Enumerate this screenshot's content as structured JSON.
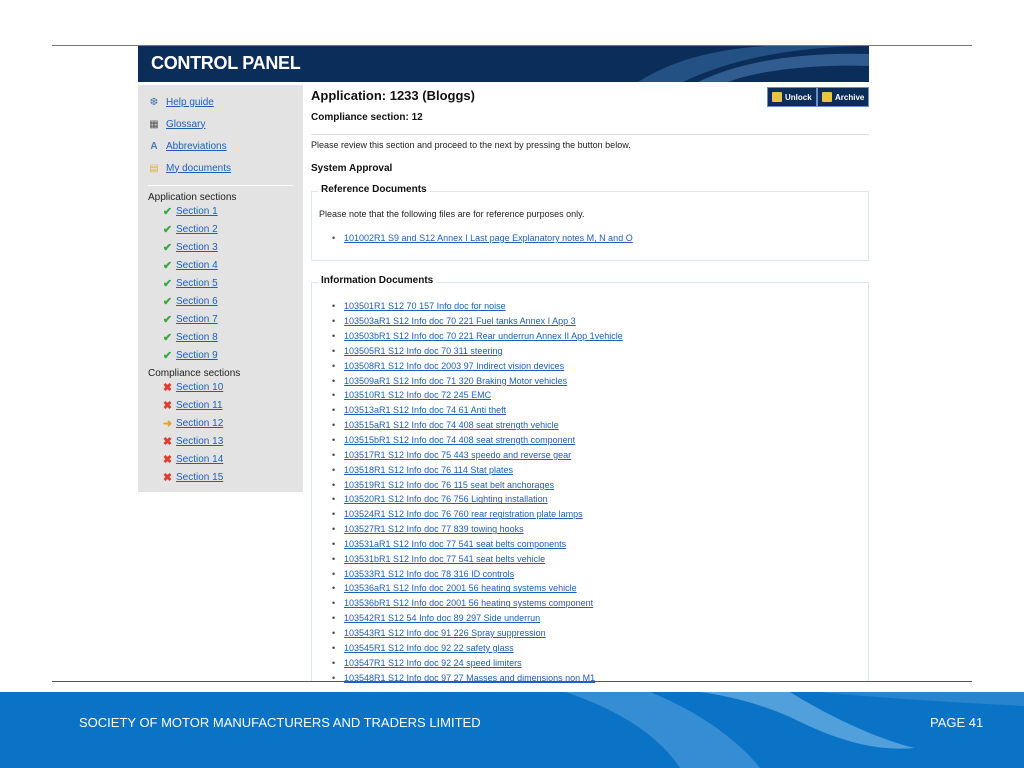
{
  "header": {
    "title": "CONTROL PANEL"
  },
  "sidebar": {
    "links": [
      {
        "label": "Help guide",
        "icon": "help-icon"
      },
      {
        "label": "Glossary",
        "icon": "glossary-icon"
      },
      {
        "label": "Abbreviations",
        "icon": "abbreviations-icon"
      },
      {
        "label": "My documents",
        "icon": "folder-icon"
      }
    ],
    "application_heading": "Application sections",
    "application_sections": [
      {
        "label": "Section 1",
        "status": "complete"
      },
      {
        "label": "Section 2",
        "status": "complete"
      },
      {
        "label": "Section 3",
        "status": "complete"
      },
      {
        "label": "Section 4",
        "status": "complete"
      },
      {
        "label": "Section 5",
        "status": "complete"
      },
      {
        "label": "Section 6",
        "status": "complete"
      },
      {
        "label": "Section 7",
        "status": "complete"
      },
      {
        "label": "Section 8",
        "status": "complete"
      },
      {
        "label": "Section 9",
        "status": "complete"
      }
    ],
    "compliance_heading": "Compliance sections",
    "compliance_sections": [
      {
        "label": "Section 10",
        "status": "incomplete"
      },
      {
        "label": "Section 11",
        "status": "incomplete"
      },
      {
        "label": "Section 12",
        "status": "current"
      },
      {
        "label": "Section 13",
        "status": "incomplete"
      },
      {
        "label": "Section 14",
        "status": "incomplete"
      },
      {
        "label": "Section 15",
        "status": "incomplete"
      }
    ]
  },
  "main": {
    "application_title": "Application: 1233 (Bloggs)",
    "compliance_title": "Compliance section: 12",
    "unlock_label": "Unlock",
    "archive_label": "Archive",
    "instructions": "Please review this section and proceed to the next by pressing the button below.",
    "system_approval": "System Approval",
    "reference": {
      "legend": "Reference Documents",
      "note": "Please note that the following files are for reference purposes only.",
      "links": [
        "101002R1 S9 and S12 Annex I Last page Explanatory notes M, N and O"
      ]
    },
    "information": {
      "legend": "Information Documents",
      "links": [
        "103501R1 S12 70 157 Info doc for noise",
        "103503aR1 S12 Info doc 70 221 Fuel tanks Annex I App 3",
        "103503bR1 S12 Info doc 70 221 Rear underrun Annex II App 1vehicle",
        "103505R1 S12 Info doc 70 311 steering",
        "103508R1 S12 Info doc 2003 97 Indirect vision devices",
        "103509aR1 S12 Info doc 71 320 Braking Motor vehicles",
        "103510R1 S12 Info doc 72 245 EMC",
        "103513aR1 S12 Info doc 74 61 Anti theft",
        "103515aR1 S12 Info doc 74 408 seat strength vehicle",
        "103515bR1 S12 Info doc 74 408 seat strength component",
        "103517R1 S12 Info doc 75 443 speedo and reverse gear",
        "103518R1 S12 Info doc 76 114 Stat plates",
        "103519R1 S12 Info doc 76 115 seat belt anchorages",
        "103520R1 S12 Info doc 76 756 Lighting installation",
        "103524R1 S12 Info doc 76 760 rear registration plate lamps",
        "103527R1 S12 Info doc 77 839 towing hooks",
        "103531aR1 S12 Info doc 77 541 seat belts components",
        "103531bR1 S12 Info doc 77 541 seat belts vehicle",
        "103533R1 S12 Info doc 78 316 ID controls",
        "103536aR1 S12 Info doc 2001 56 heating systems vehicle",
        "103536bR1 S12 Info doc 2001 56 heating systems component",
        "103542R1 S12 54 Info doc 89 297 Side underrun",
        "103543R1 S12 Info doc 91 226 Spray suppression",
        "103545R1 S12 Info doc 92 22 safety glass",
        "103547R1 S12 Info doc 92 24 speed limiters",
        "103548R1 S12 Info doc 97 27 Masses and dimensions non M1"
      ]
    }
  },
  "footer": {
    "org": "SOCIETY OF MOTOR MANUFACTURERS AND TRADERS LIMITED",
    "page": "PAGE 41"
  },
  "colors": {
    "header_bg": "#0a2d59",
    "footer_bg": "#0a73c6",
    "link": "#1f5fb8",
    "check": "#3aa845",
    "cross": "#e23b30",
    "arrow": "#e6a21a"
  }
}
